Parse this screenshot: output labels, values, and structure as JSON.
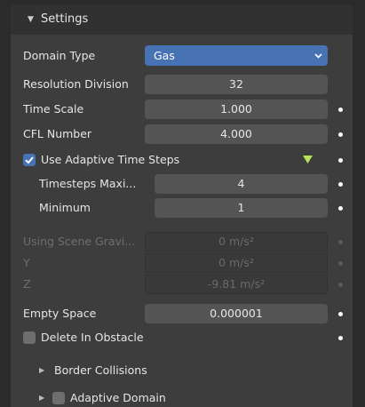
{
  "panel": {
    "title": "Settings",
    "domain_type": {
      "label": "Domain Type",
      "value": "Gas"
    },
    "resolution_division": {
      "label": "Resolution Division",
      "value": "32"
    },
    "time_scale": {
      "label": "Time Scale",
      "value": "1.000"
    },
    "cfl_number": {
      "label": "CFL Number",
      "value": "4.000"
    },
    "use_adaptive_time_steps": {
      "label": "Use Adaptive Time Steps",
      "checked": true
    },
    "timesteps_maximum": {
      "label": "Timesteps Maxi...",
      "value": "4"
    },
    "timesteps_minimum": {
      "label": "Minimum",
      "value": "1"
    },
    "gravity": {
      "label": "Using Scene Gravi...",
      "x": "0 m/s²",
      "y_label": "Y",
      "y": "0 m/s²",
      "z_label": "Z",
      "z": "-9.81 m/s²"
    },
    "empty_space": {
      "label": "Empty Space",
      "value": "0.000001"
    },
    "delete_in_obstacle": {
      "label": "Delete In Obstacle",
      "checked": false
    },
    "border_collisions": {
      "label": "Border Collisions"
    },
    "adaptive_domain": {
      "label": "Adaptive Domain",
      "checked": false
    }
  },
  "colors": {
    "panel_bg": "#3d3d3d",
    "field_bg": "#545454",
    "accent": "#4772b3",
    "keyframe_marker": "#b6e35a"
  },
  "icons": {
    "collapse": "triangle-down-icon",
    "expand": "triangle-right-icon",
    "dropdown": "chevron-down-icon",
    "keyframe": "keyframe-dot-icon",
    "preset": "green-triangle-icon"
  }
}
